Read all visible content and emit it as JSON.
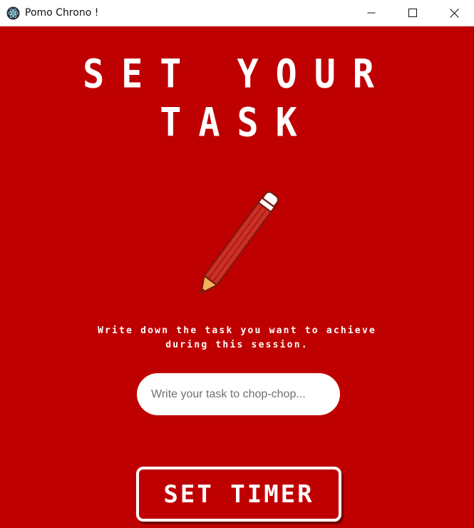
{
  "window": {
    "title": "Pomo Chrono !",
    "app_icon": "electron-logo-icon",
    "controls": {
      "minimize": "minimize-icon",
      "maximize": "maximize-icon",
      "close": "close-icon"
    }
  },
  "main": {
    "heading_line_1": "SET YOUR",
    "heading_line_2": "TASK",
    "illustration_icon": "pencil-icon",
    "instruction_line_1": "Write down the task you want to achieve",
    "instruction_line_2": "during this session.",
    "task_input": {
      "value": "",
      "placeholder": "Write your task to chop-chop..."
    },
    "submit_label": "SET TIMER"
  },
  "colors": {
    "background": "#bf0000",
    "text": "#ffffff",
    "input_background": "#ffffff",
    "button_border": "#ffffff"
  }
}
